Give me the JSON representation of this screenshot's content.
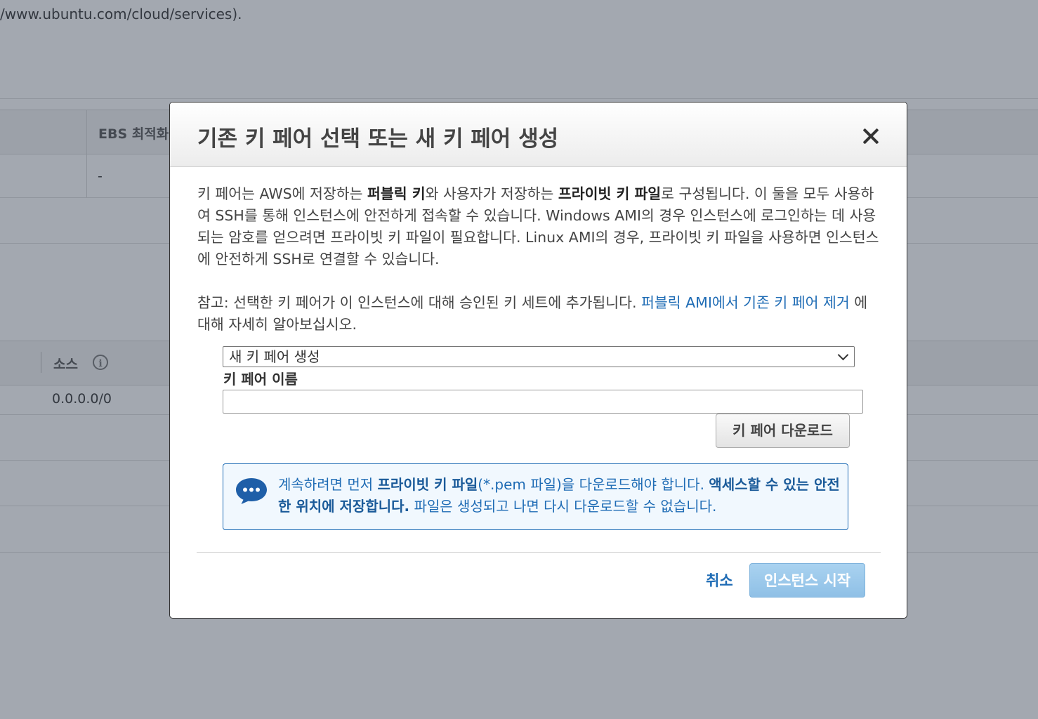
{
  "background": {
    "url_text": "/www.ubuntu.com/cloud/services).",
    "col_ebs": "EBS 최적화",
    "cell_dash": "-",
    "col_source": "소스",
    "source_value": "0.0.0.0/0"
  },
  "modal": {
    "title": "기존 키 페어 선택 또는 새 키 페어 생성",
    "intro": {
      "t1": "키 페어는 AWS에 저장하는 ",
      "b1": "퍼블릭 키",
      "t2": "와 사용자가 저장하는 ",
      "b2": "프라이빗 키 파일",
      "t3": "로 구성됩니다. 이 둘을 모두 사용하여 SSH를 통해 인스턴스에 안전하게 접속할 수 있습니다. Windows AMI의 경우 인스턴스에 로그인하는 데 사용되는 암호를 얻으려면 프라이빗 키 파일이 필요합니다. Linux AMI의 경우, 프라이빗 키 파일을 사용하면 인스턴스에 안전하게 SSH로 연결할 수 있습니다."
    },
    "note": {
      "text": "참고: 선택한 키 페어가 이 인스턴스에 대해 승인된 키 세트에 추가됩니다. ",
      "link": "퍼블릭 AMI에서 기존 키 페어 제거",
      "after": " 에 대해 자세히 알아보십시오."
    },
    "select_value": "새 키 페어 생성",
    "key_name_label": "키 페어 이름",
    "key_name_value": "",
    "download_button": "키 페어 다운로드",
    "notice": {
      "t1": "계속하려면 먼저 ",
      "b1": "프라이빗 키 파일",
      "t2": "(*.pem 파일)을 다운로드해야 합니다. ",
      "b2": "액세스할 수 있는 안전한 위치에 저장합니다.",
      "t3": " 파일은 생성되고 나면 다시 다운로드할 수 없습니다."
    },
    "cancel_button": "취소",
    "launch_button": "인스턴스 시작"
  },
  "colors": {
    "accent": "#1f6cb5",
    "launch_button": "#9ccaeb",
    "notice_bg": "#f1f8fe"
  }
}
